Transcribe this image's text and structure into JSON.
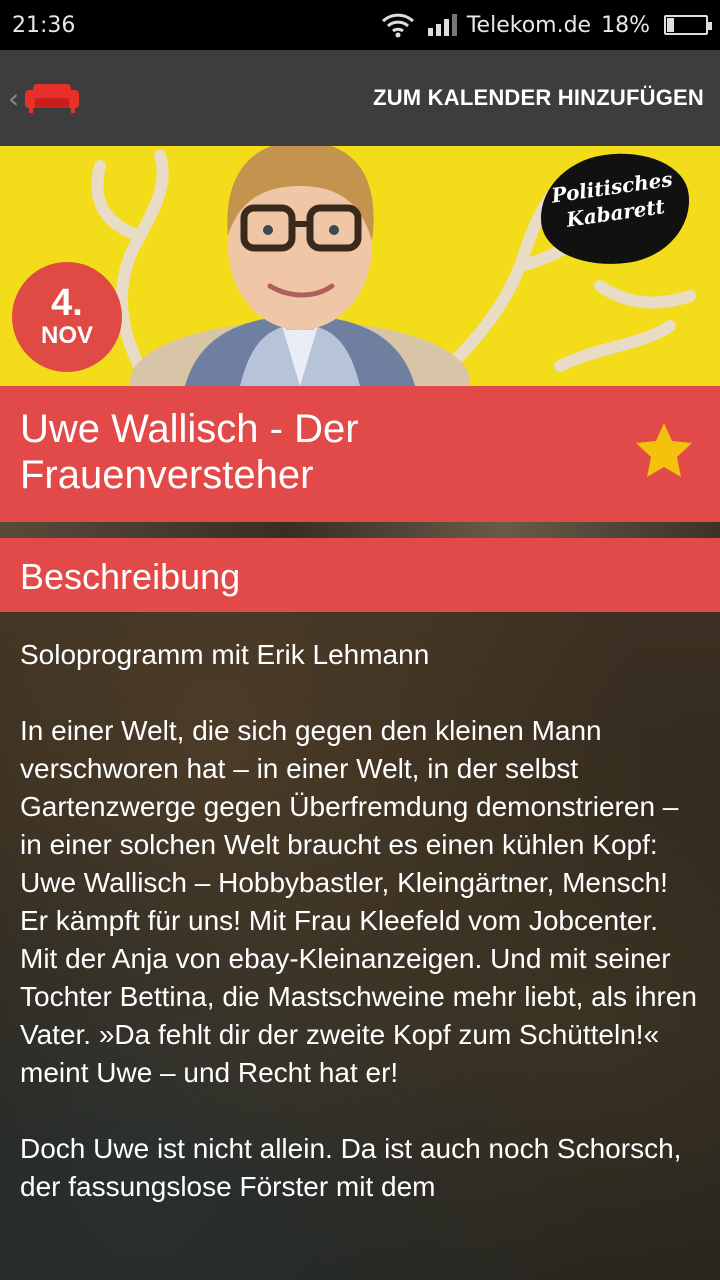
{
  "status": {
    "time": "21:36",
    "carrier": "Telekom.de",
    "battery": "18%",
    "battery_level": 0.18
  },
  "appbar": {
    "action_label": "ZUM KALENDER HINZUFÜGEN"
  },
  "hero": {
    "stamp_text": "Politisches Kabarett",
    "date_day": "4.",
    "date_month": "NOV"
  },
  "event": {
    "title": "Uwe Wallisch - Der Frauenversteher",
    "favorite": true
  },
  "description": {
    "heading": "Beschreibung",
    "paragraphs": [
      "Soloprogramm mit Erik Lehmann",
      "In einer Welt, die sich gegen den kleinen Mann verschworen hat – in einer Welt, in der selbst Gartenzwerge gegen Überfremdung demonstrieren – in einer solchen Welt braucht es einen kühlen Kopf: Uwe Wallisch – Hobbybastler, Kleingärtner, Mensch!\nEr kämpft für uns! Mit Frau Kleefeld vom Jobcenter. Mit der Anja von ebay-Kleinanzeigen. Und mit seiner Tochter Bettina, die Mastschweine mehr liebt, als ihren Vater. »Da fehlt dir der zweite Kopf zum Schütteln!« meint Uwe – und Recht hat er!",
      "Doch Uwe ist nicht allein. Da ist auch noch Schorsch, der fassungslose Förster mit dem"
    ]
  },
  "colors": {
    "accent": "#e14a48",
    "appbar": "#3d3d3d",
    "hero_bg": "#f3dc1a",
    "star": "#f4c20d"
  }
}
